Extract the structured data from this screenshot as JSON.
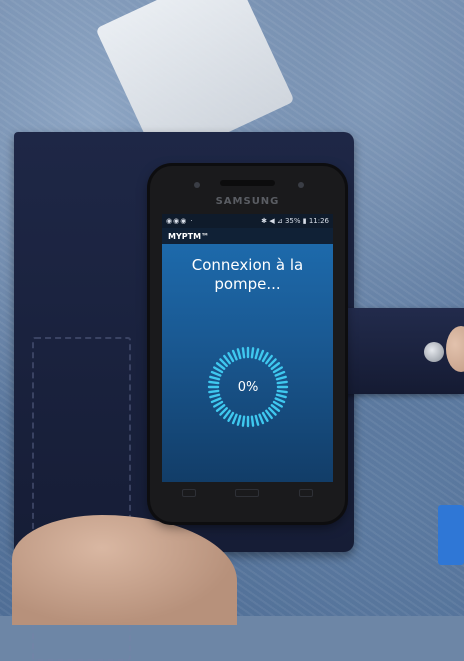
{
  "photo": {
    "description_free": true
  },
  "phone": {
    "brand": "SAMSUNG",
    "status_bar": {
      "left_icons": "◉◉◉ ·",
      "right_text": "✱ ◀ ⊿ 35% ▮ 11:26"
    },
    "app_title": "MYPTM™",
    "message": "Connexion à la pompe...",
    "progress": {
      "label": "0%",
      "value": 0
    }
  },
  "colors": {
    "screen_top": "#1e6fb3",
    "screen_bottom": "#123d68",
    "ring": "#3fc8ef"
  }
}
